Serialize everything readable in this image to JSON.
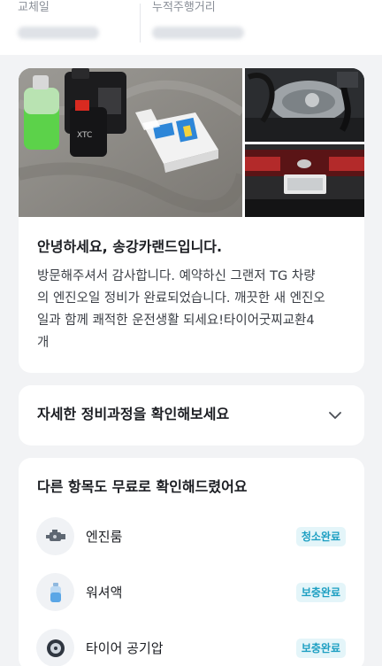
{
  "summary": {
    "left_label": "교체일",
    "right_label": "누적주행거리"
  },
  "message": {
    "title": "안녕하세요, 송강카랜드입니다.",
    "body": "방문해주셔서 감사합니다. 예약하신 그랜저 TG 차량\n의 엔진오일 정비가 완료되었습니다. 깨끗한 새 엔진오\n일과 함께 쾌적한 운전생활 되세요!타이어굿찌교환4\n개"
  },
  "process": {
    "title": "자세한 정비과정을 확인해보세요",
    "icon": "chevron-down-icon"
  },
  "checks": {
    "title": "다른 항목도 무료로 확인해드렸어요",
    "items": [
      {
        "label": "엔진룸",
        "status": "청소완료",
        "icon": "engine-icon"
      },
      {
        "label": "워셔액",
        "status": "보충완료",
        "icon": "washer-fluid-icon"
      },
      {
        "label": "타이어 공기압",
        "status": "보충완료",
        "icon": "tire-icon"
      }
    ]
  },
  "colors": {
    "badge_text": "#1d9fc2",
    "badge_bg": "#e4f5f9",
    "page_bg": "#f2f3f5"
  }
}
